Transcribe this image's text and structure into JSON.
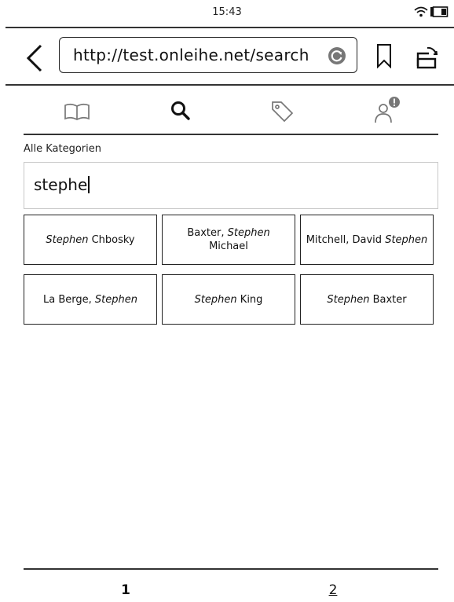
{
  "status": {
    "time": "15:43"
  },
  "browser": {
    "url": "http://test.onleihe.net/search"
  },
  "tabs": [
    {
      "icon": "book-icon"
    },
    {
      "icon": "search-icon"
    },
    {
      "icon": "tag-icon"
    },
    {
      "icon": "user-alert-icon"
    }
  ],
  "search": {
    "category": "Alle Kategorien",
    "query": "stephe"
  },
  "results": [
    [
      {
        "text": "Stephen",
        "italic": true
      },
      {
        "text": " Chbosky",
        "italic": false
      }
    ],
    [
      {
        "text": "Baxter, ",
        "italic": false
      },
      {
        "text": "Stephen",
        "italic": true
      },
      {
        "text": " Michael",
        "italic": false
      }
    ],
    [
      {
        "text": "Mitchell, David ",
        "italic": false
      },
      {
        "text": "Stephen",
        "italic": true
      }
    ],
    [
      {
        "text": "La Berge, ",
        "italic": false
      },
      {
        "text": "Stephen",
        "italic": true
      }
    ],
    [
      {
        "text": "Stephen",
        "italic": true
      },
      {
        "text": " King",
        "italic": false
      }
    ],
    [
      {
        "text": "Stephen",
        "italic": true
      },
      {
        "text": " Baxter",
        "italic": false
      }
    ]
  ],
  "pagination": {
    "page1": "1",
    "page2": "2"
  }
}
